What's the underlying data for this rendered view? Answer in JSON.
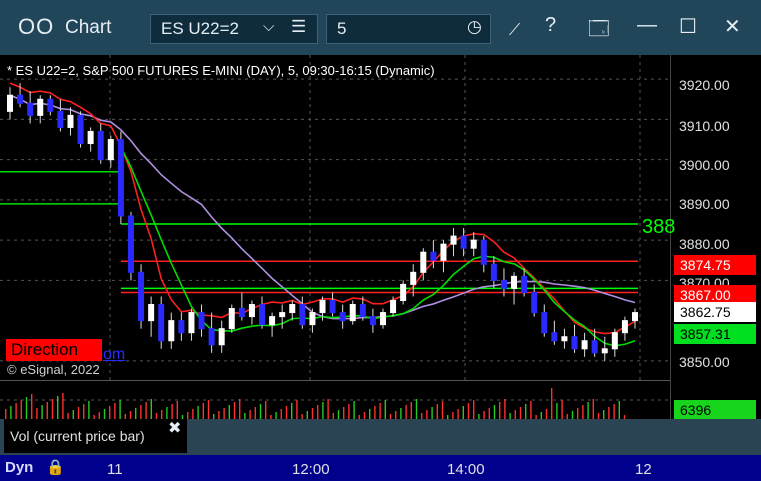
{
  "app": {
    "icon": "OO",
    "title": "Chart"
  },
  "toolbar": {
    "symbol": "ES U22=2",
    "interval": "5",
    "icons": [
      "chevron-down-icon",
      "list-icon",
      "clock-icon",
      "draw-tool-icon",
      "help-icon",
      "page-setup-icon",
      "minimize-icon",
      "maximize-icon",
      "close-icon"
    ],
    "help_glyph": "?"
  },
  "chart": {
    "label": "* ES U22=2, S&P 500 FUTURES E-MINI (DAY), 5, 09:30-16:15 (Dynamic)",
    "direction": "Direction",
    "com_text": "om",
    "copyright": "© eSignal, 2022",
    "level_label": "388",
    "y_ticks": [
      "3920.00",
      "3910.00",
      "3900.00",
      "3890.00",
      "3880.00",
      "3870.00",
      "3850.00"
    ],
    "price_boxes": {
      "red1": "3874.75",
      "red2": "3867.00",
      "last": "3862.75",
      "green": "3857.31"
    },
    "x_ticks": [
      "11",
      "12:00",
      "14:00",
      "12"
    ]
  },
  "volume": {
    "label": "Vol (current price bar)",
    "value": "6396",
    "close": "✖"
  },
  "bottom": {
    "dyn": "Dyn"
  },
  "chart_data": {
    "type": "candlestick",
    "symbol": "ES U22=2",
    "y_ticks": [
      3850,
      3870,
      3880,
      3890,
      3900,
      3910,
      3920
    ],
    "ylim": [
      3845,
      3926
    ],
    "x_tick_labels": [
      "11",
      "12:00",
      "14:00",
      "12"
    ],
    "horizontal_levels": [
      {
        "color": "#00e000",
        "value": 3897
      },
      {
        "color": "#00e000",
        "value": 3889
      },
      {
        "color": "#00ff00",
        "value": 3884
      },
      {
        "color": "#ff2020",
        "value": 3874.75
      },
      {
        "color": "#ff2020",
        "value": 3867
      },
      {
        "color": "#00ff00",
        "value": 3868
      }
    ],
    "price_labels": {
      "resistance_1": 3874.75,
      "resistance_2": 3867.0,
      "last": 3862.75,
      "moving_average": 3857.31
    },
    "candles": [
      [
        3912,
        3918,
        3910,
        3916
      ],
      [
        3916,
        3919,
        3913,
        3914
      ],
      [
        3914,
        3917,
        3909,
        3911
      ],
      [
        3911,
        3916,
        3909,
        3915
      ],
      [
        3915,
        3916,
        3911,
        3912
      ],
      [
        3912,
        3915,
        3907,
        3908
      ],
      [
        3908,
        3913,
        3906,
        3911
      ],
      [
        3911,
        3912,
        3903,
        3904
      ],
      [
        3904,
        3908,
        3902,
        3907
      ],
      [
        3907,
        3909,
        3899,
        3900
      ],
      [
        3900,
        3906,
        3898,
        3905
      ],
      [
        3905,
        3907,
        3884,
        3886
      ],
      [
        3886,
        3887,
        3870,
        3872
      ],
      [
        3872,
        3874,
        3858,
        3860
      ],
      [
        3860,
        3866,
        3856,
        3864
      ],
      [
        3864,
        3866,
        3853,
        3855
      ],
      [
        3855,
        3862,
        3853,
        3860
      ],
      [
        3860,
        3862,
        3855,
        3857
      ],
      [
        3857,
        3863,
        3855,
        3862
      ],
      [
        3862,
        3864,
        3856,
        3858
      ],
      [
        3858,
        3862,
        3852,
        3854
      ],
      [
        3854,
        3860,
        3852,
        3858
      ],
      [
        3858,
        3864,
        3857,
        3863
      ],
      [
        3863,
        3867,
        3860,
        3861
      ],
      [
        3861,
        3865,
        3859,
        3864
      ],
      [
        3864,
        3866,
        3858,
        3859
      ],
      [
        3859,
        3862,
        3856,
        3861
      ],
      [
        3861,
        3864,
        3858,
        3862
      ],
      [
        3862,
        3865,
        3860,
        3864
      ],
      [
        3864,
        3866,
        3858,
        3859
      ],
      [
        3859,
        3863,
        3857,
        3862
      ],
      [
        3862,
        3866,
        3860,
        3865
      ],
      [
        3865,
        3867,
        3861,
        3862
      ],
      [
        3862,
        3864,
        3858,
        3860
      ],
      [
        3860,
        3865,
        3859,
        3864
      ],
      [
        3864,
        3866,
        3860,
        3861
      ],
      [
        3861,
        3863,
        3857,
        3859
      ],
      [
        3859,
        3863,
        3858,
        3862
      ],
      [
        3862,
        3866,
        3861,
        3865
      ],
      [
        3865,
        3870,
        3864,
        3869
      ],
      [
        3869,
        3874,
        3866,
        3872
      ],
      [
        3872,
        3878,
        3870,
        3877
      ],
      [
        3877,
        3880,
        3873,
        3875
      ],
      [
        3875,
        3880,
        3872,
        3879
      ],
      [
        3879,
        3883,
        3876,
        3881
      ],
      [
        3881,
        3883,
        3876,
        3878
      ],
      [
        3878,
        3882,
        3876,
        3880
      ],
      [
        3880,
        3881,
        3872,
        3874
      ],
      [
        3874,
        3876,
        3868,
        3870
      ],
      [
        3870,
        3873,
        3866,
        3868
      ],
      [
        3868,
        3872,
        3864,
        3871
      ],
      [
        3871,
        3873,
        3866,
        3867
      ],
      [
        3867,
        3869,
        3861,
        3862
      ],
      [
        3862,
        3864,
        3856,
        3857
      ],
      [
        3857,
        3860,
        3854,
        3855
      ],
      [
        3855,
        3858,
        3853,
        3856
      ],
      [
        3856,
        3859,
        3852,
        3853
      ],
      [
        3853,
        3857,
        3851,
        3855
      ],
      [
        3855,
        3858,
        3851,
        3852
      ],
      [
        3852,
        3856,
        3850,
        3853
      ],
      [
        3853,
        3858,
        3851,
        3857
      ],
      [
        3857,
        3861,
        3855,
        3860
      ],
      [
        3860,
        3863,
        3858,
        3862
      ]
    ],
    "volume_last": 6396
  }
}
